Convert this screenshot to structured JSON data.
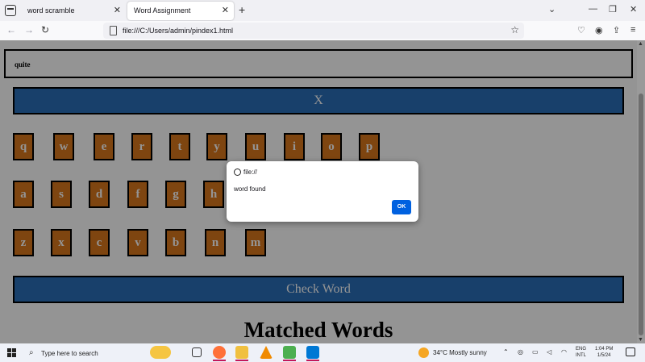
{
  "browser": {
    "tabs": [
      {
        "label": "word scramble"
      },
      {
        "label": "Word Assignment"
      }
    ],
    "new_tab_label": "+",
    "url": "file:///C:/Users/admin/pindex1.html"
  },
  "page": {
    "display_text": "quite",
    "clear_button_label": "X",
    "keyboard_rows": [
      [
        "q",
        "w",
        "e",
        "r",
        "t",
        "y",
        "u",
        "i",
        "o",
        "p"
      ],
      [
        "a",
        "s",
        "d",
        "f",
        "g",
        "h"
      ],
      [
        "z",
        "x",
        "c",
        "v",
        "b",
        "n",
        "m"
      ]
    ],
    "check_button_label": "Check Word",
    "matched_heading": "Matched Words"
  },
  "dialog": {
    "origin": "file://",
    "message": "word found",
    "ok_label": "OK"
  },
  "taskbar": {
    "search_placeholder": "Type here to search",
    "weather": "34°C  Mostly sunny",
    "lang_line1": "ENG",
    "lang_line2": "INTL",
    "time": "1:04 PM",
    "date": "1/5/24"
  },
  "colors": {
    "key_bg": "#d9771c",
    "button_bg": "#2a6fb8",
    "dialog_ok": "#0061e0"
  }
}
